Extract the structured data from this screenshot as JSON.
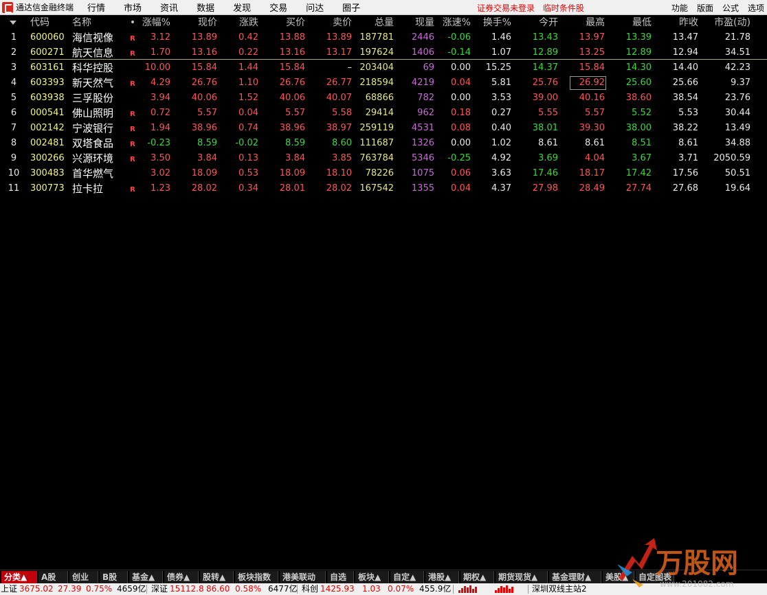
{
  "app": {
    "title": "通达信金融终端",
    "menu": [
      "行情",
      "市场",
      "资讯",
      "数据",
      "发现",
      "交易",
      "问达",
      "圈子"
    ],
    "notice": [
      "证券交易未登录",
      "临时条件股"
    ],
    "right_menu": [
      "功能",
      "版面",
      "公式",
      "选项"
    ]
  },
  "table": {
    "headers": [
      "代码",
      "名称",
      "•",
      "涨幅%",
      "现价",
      "涨跌",
      "买价",
      "卖价",
      "总量",
      "现量",
      "涨速%",
      "换手%",
      "今开",
      "最高",
      "最低",
      "昨收",
      "市盈(动)"
    ],
    "rows": [
      {
        "idx": "1",
        "code": "600060",
        "name": "海信视像",
        "flag": "R",
        "chg_pct": "3.12",
        "price": "13.89",
        "chg": "0.42",
        "bid": "13.88",
        "ask": "13.89",
        "vol": "187781",
        "cur_vol": "2446",
        "speed": "-0.06",
        "turnover": "1.46",
        "open": "13.43",
        "high": "13.97",
        "low": "13.39",
        "prev_close": "13.47",
        "pe": "21.78"
      },
      {
        "idx": "2",
        "code": "600271",
        "name": "航天信息",
        "flag": "R",
        "chg_pct": "1.70",
        "price": "13.16",
        "chg": "0.22",
        "bid": "13.16",
        "ask": "13.17",
        "vol": "197624",
        "cur_vol": "1406",
        "speed": "-0.14",
        "turnover": "1.07",
        "open": "12.89",
        "high": "13.25",
        "low": "12.89",
        "prev_close": "12.94",
        "pe": "34.51"
      },
      {
        "idx": "3",
        "code": "603161",
        "name": "科华控股",
        "flag": "",
        "chg_pct": "10.00",
        "price": "15.84",
        "chg": "1.44",
        "bid": "15.84",
        "ask": "–",
        "vol": "203404",
        "cur_vol": "69",
        "speed": "0.00",
        "turnover": "15.25",
        "open": "14.37",
        "high": "15.84",
        "low": "14.30",
        "prev_close": "14.40",
        "pe": "42.23"
      },
      {
        "idx": "4",
        "code": "603393",
        "name": "新天然气",
        "flag": "R",
        "chg_pct": "4.29",
        "price": "26.76",
        "chg": "1.10",
        "bid": "26.76",
        "ask": "26.77",
        "vol": "218594",
        "cur_vol": "4219",
        "speed": "0.04",
        "turnover": "5.81",
        "open": "25.76",
        "high": "26.92",
        "low": "25.60",
        "prev_close": "25.66",
        "pe": "9.37"
      },
      {
        "idx": "5",
        "code": "603938",
        "name": "三孚股份",
        "flag": "",
        "chg_pct": "3.94",
        "price": "40.06",
        "chg": "1.52",
        "bid": "40.06",
        "ask": "40.07",
        "vol": "68866",
        "cur_vol": "782",
        "speed": "0.00",
        "turnover": "3.53",
        "open": "39.00",
        "high": "40.16",
        "low": "38.60",
        "prev_close": "38.54",
        "pe": "23.76"
      },
      {
        "idx": "6",
        "code": "000541",
        "name": "佛山照明",
        "flag": "R",
        "chg_pct": "0.72",
        "price": "5.57",
        "chg": "0.04",
        "bid": "5.57",
        "ask": "5.58",
        "vol": "29414",
        "cur_vol": "962",
        "speed": "0.18",
        "turnover": "0.27",
        "open": "5.55",
        "high": "5.57",
        "low": "5.52",
        "prev_close": "5.53",
        "pe": "30.44"
      },
      {
        "idx": "7",
        "code": "002142",
        "name": "宁波银行",
        "flag": "R",
        "chg_pct": "1.94",
        "price": "38.96",
        "chg": "0.74",
        "bid": "38.96",
        "ask": "38.97",
        "vol": "259119",
        "cur_vol": "4531",
        "speed": "0.08",
        "turnover": "0.40",
        "open": "38.01",
        "high": "39.30",
        "low": "38.00",
        "prev_close": "38.22",
        "pe": "13.49"
      },
      {
        "idx": "8",
        "code": "002481",
        "name": "双塔食品",
        "flag": "R",
        "chg_pct": "-0.23",
        "price": "8.59",
        "chg": "-0.02",
        "bid": "8.59",
        "ask": "8.60",
        "vol": "111687",
        "cur_vol": "1326",
        "speed": "0.00",
        "turnover": "1.02",
        "open": "8.61",
        "high": "8.61",
        "low": "8.51",
        "prev_close": "8.61",
        "pe": "34.88"
      },
      {
        "idx": "9",
        "code": "300266",
        "name": "兴源环境",
        "flag": "R",
        "chg_pct": "3.50",
        "price": "3.84",
        "chg": "0.13",
        "bid": "3.84",
        "ask": "3.85",
        "vol": "763784",
        "cur_vol": "5346",
        "speed": "-0.25",
        "turnover": "4.92",
        "open": "3.69",
        "high": "4.04",
        "low": "3.67",
        "prev_close": "3.71",
        "pe": "2050.59"
      },
      {
        "idx": "10",
        "code": "300483",
        "name": "首华燃气",
        "flag": "",
        "chg_pct": "3.02",
        "price": "18.09",
        "chg": "0.53",
        "bid": "18.09",
        "ask": "18.10",
        "vol": "78226",
        "cur_vol": "1075",
        "speed": "0.06",
        "turnover": "3.63",
        "open": "17.46",
        "high": "18.17",
        "low": "17.42",
        "prev_close": "17.56",
        "pe": "50.51"
      },
      {
        "idx": "11",
        "code": "300773",
        "name": "拉卡拉",
        "flag": "R",
        "chg_pct": "1.23",
        "price": "28.02",
        "chg": "0.34",
        "bid": "28.01",
        "ask": "28.02",
        "vol": "167542",
        "cur_vol": "1355",
        "speed": "0.04",
        "turnover": "4.37",
        "open": "27.98",
        "high": "28.49",
        "low": "27.74",
        "prev_close": "27.68",
        "pe": "19.64"
      }
    ]
  },
  "tabs": [
    "分类▲",
    "A股",
    "创业",
    "B股",
    "基金▲",
    "债券▲",
    "股转▲",
    "板块指数",
    "港美联动",
    "自选",
    "板块▲",
    "自定▲",
    "港股▲",
    "期权▲",
    "期货现货▲",
    "基金理财▲",
    "美股▲",
    "自定图表"
  ],
  "status": {
    "sh_label": "上证",
    "sh_index": "3675.02",
    "sh_chg": "27.39",
    "sh_pct": "0.75%",
    "sh_amt": "4659亿",
    "sz_label": "深证",
    "sz_index": "15112.8",
    "sz_chg": "86.60",
    "sz_pct": "0.58%",
    "sz_amt": "6477亿",
    "kc_label": "科创",
    "kc_index": "1425.93",
    "kc_chg": "1.03",
    "kc_pct": "0.07%",
    "kc_amt": "455.9亿",
    "server": "深圳双线主站2"
  },
  "watermark": {
    "brand": "万股网",
    "url": "www.201082.com"
  },
  "colors": {
    "up": "#ff5555",
    "down": "#3ad93a",
    "bg": "#000000",
    "active_tab": "#c2000b"
  }
}
